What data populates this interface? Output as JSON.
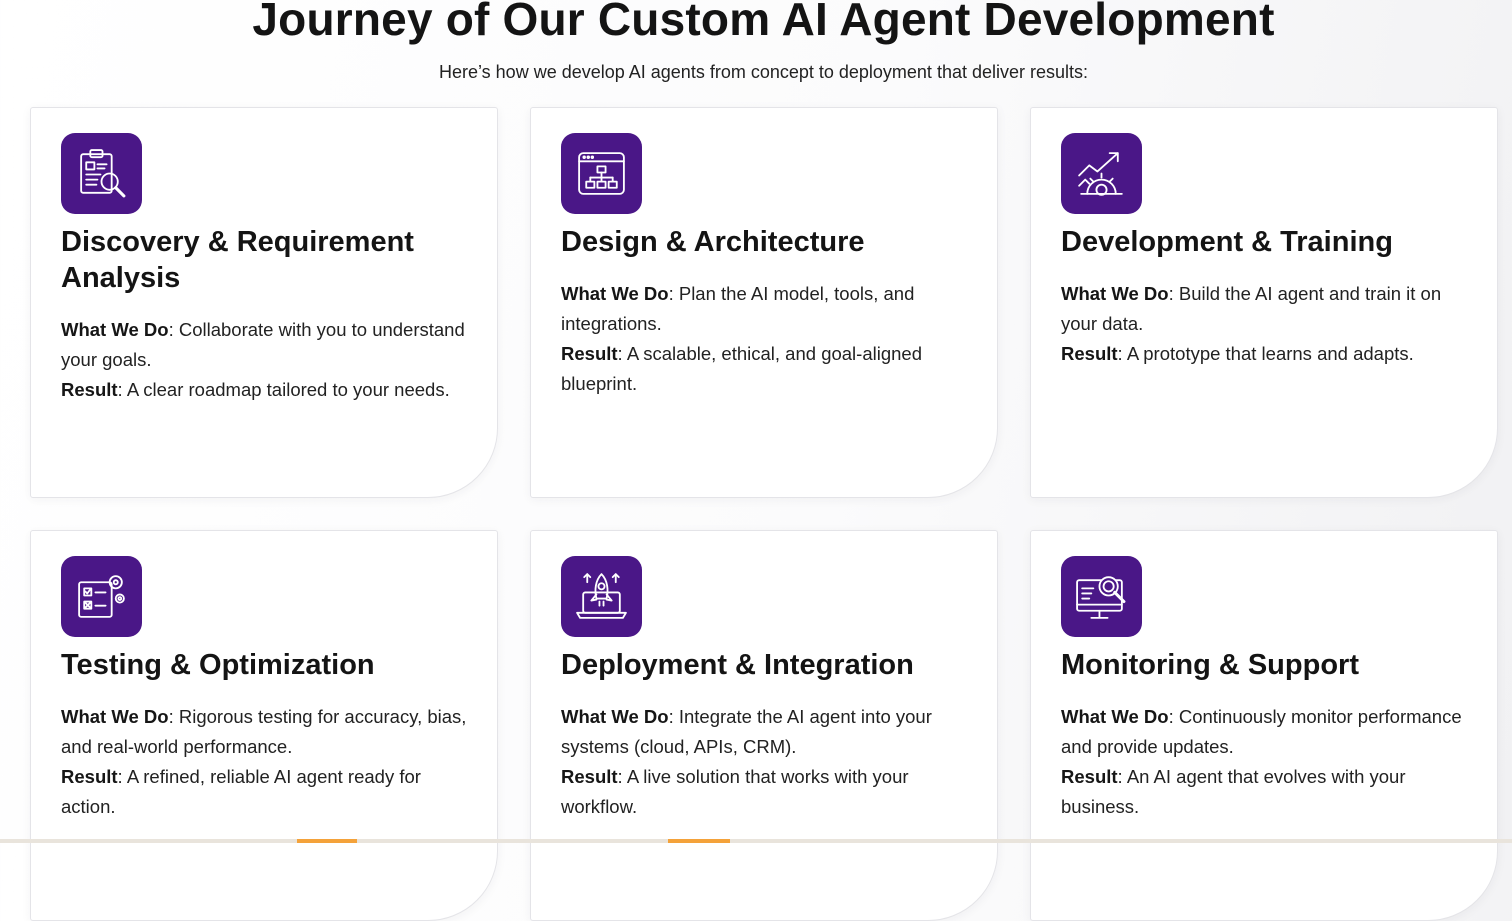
{
  "header": {
    "title": "Journey of Our Custom AI Agent Development",
    "subtitle": "Here’s how we develop AI agents from concept to deployment that deliver results:"
  },
  "labels": {
    "what_we_do": "What We Do",
    "result": "Result"
  },
  "theme": {
    "icon_background": "#4a1787",
    "accent": "#f4a23a"
  },
  "cards": [
    {
      "title": "Discovery & Requirement Analysis",
      "icon": "clipboard-search-icon",
      "what_we_do": "Collaborate with you to understand your goals.",
      "result": "A clear roadmap tailored to your needs."
    },
    {
      "title": "Design & Architecture",
      "icon": "architecture-diagram-icon",
      "what_we_do": "Plan the AI model, tools, and integrations.",
      "result": "A scalable, ethical, and goal-aligned blueprint."
    },
    {
      "title": "Development & Training",
      "icon": "growth-gear-icon",
      "what_we_do": "Build the AI agent and train it on your data.",
      "result": "A prototype that learns and adapts."
    },
    {
      "title": "Testing & Optimization",
      "icon": "checklist-gear-icon",
      "what_we_do": "Rigorous testing for accuracy, bias, and real-world performance.",
      "result": "A refined, reliable AI agent ready for action."
    },
    {
      "title": "Deployment & Integration",
      "icon": "rocket-laptop-icon",
      "what_we_do": "Integrate the AI agent into your systems (cloud, APIs, CRM).",
      "result": "A live solution that works with your workflow."
    },
    {
      "title": "Monitoring & Support",
      "icon": "monitor-search-icon",
      "what_we_do": "Continuously monitor performance and provide updates.",
      "result": "An AI agent that evolves with your business."
    }
  ]
}
